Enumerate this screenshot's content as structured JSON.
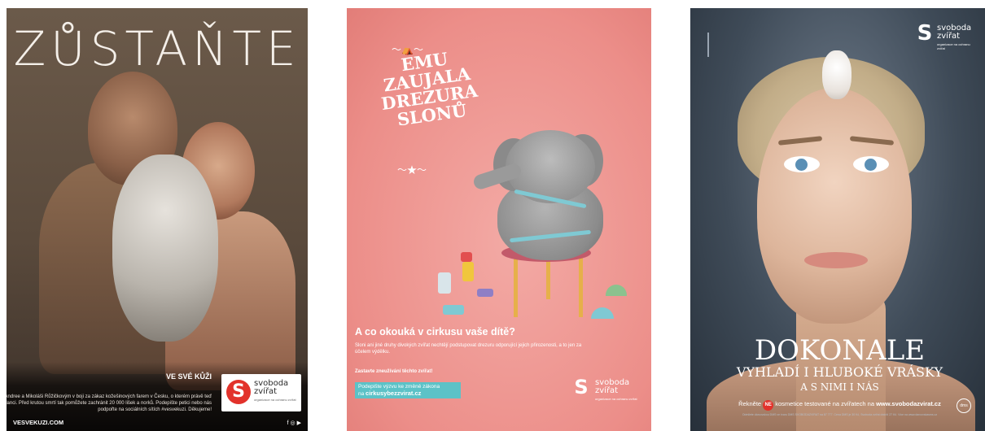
{
  "poster1": {
    "headline": "ZŮSTAŇTE",
    "section_title": "VE SVÉ KŮŽI",
    "body": "Přidejte se k Andree a Mikoláši Růžičkovým v boji za zákaz kožešinových farem v Česku, o kterém právě teď jednají poslanci. Před krutou smrtí tak pomůžete zachránit 20 000 lišek a norků. Podepište petici nebo nás podpořte na sociálních sítích #vesvekuzi. Děkujeme!",
    "url": "VESVEKUZI.COM",
    "social_icons": "f ◎ ▶",
    "logo": {
      "mark": "S",
      "name_line1": "svoboda",
      "name_line2": "zvířat",
      "tagline": "organizace na ochranu zvířat"
    }
  },
  "poster2": {
    "headline_lines": [
      "EMU",
      "ZAUJALA",
      "DREZURA",
      "SLONŮ"
    ],
    "question": "A co okouká v cirkusu vaše dítě?",
    "body": "Sloni ani jiné druhy divokých zvířat nechtějí podstupovat drezuru odporující jejich přirozenosti, a to jen za účelem výdělku.",
    "stop_line": "Zastavte zneužívání těchto zvířat!",
    "sign_line": "Podepište výzvu ke změně zákona",
    "sign_prefix": "na",
    "sign_url": "cirkusybezzvirat.cz",
    "logo": {
      "mark": "S",
      "name_line1": "svoboda",
      "name_line2": "zvířat",
      "tagline": "organizace na ochranu zvířat"
    }
  },
  "poster3": {
    "headline": "DOKONALE",
    "subline": "VYHLADÍ I HLUBOKÉ VRÁSKY",
    "subline2": "A S NIMI I NÁS",
    "cta_prefix": "Řekněte",
    "cta_ne": "NE",
    "cta_middle": "kosmetice testované na zvířatech na",
    "cta_url": "www.svobodazvirat.cz",
    "fine_print": "Odešlete dárcovskou DMS ve tvaru DMS SVOBODAZVIRAT na 87 777. Cena DMS je 30 Kč, Svoboda zvířat obdrží 27 Kč. Více na www.darcovskasms.cz",
    "badge": "dms",
    "logo": {
      "mark": "S",
      "name_line1": "svoboda",
      "name_line2": "zvířat",
      "tagline": "organizace na ochranu zvířat"
    }
  }
}
